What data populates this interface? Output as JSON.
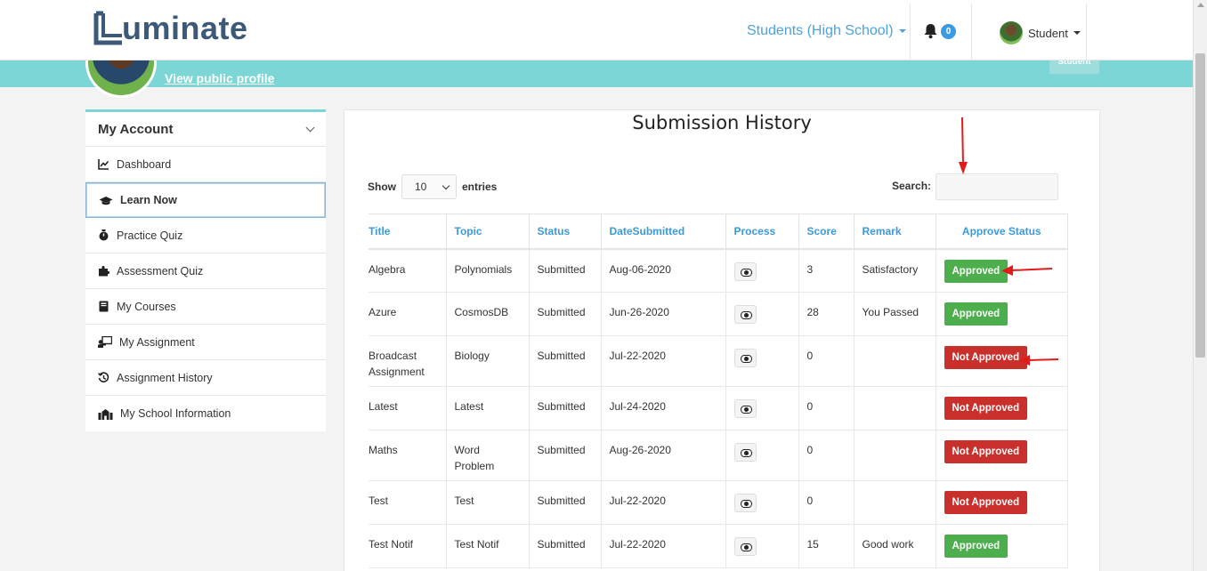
{
  "brand": {
    "name": "uminate",
    "accent": "#3c5a78"
  },
  "nav": {
    "role_menu": "Students (High School)",
    "notification_count": "0",
    "user_label": "Student"
  },
  "banner": {
    "view_profile": "View public profile",
    "role_chip": "Student",
    "color": "#7dd6d6"
  },
  "sidebar": {
    "header": "My Account",
    "items": [
      {
        "label": "Dashboard",
        "icon": "chart-line-icon"
      },
      {
        "label": "Learn Now",
        "icon": "graduation-cap-icon"
      },
      {
        "label": "Practice Quiz",
        "icon": "stopwatch-icon"
      },
      {
        "label": "Assessment Quiz",
        "icon": "puzzle-icon"
      },
      {
        "label": "My Courses",
        "icon": "book-icon"
      },
      {
        "label": "My Assignment",
        "icon": "teacher-icon"
      },
      {
        "label": "Assignment History",
        "icon": "history-icon"
      },
      {
        "label": "My School Information",
        "icon": "school-icon"
      }
    ]
  },
  "main": {
    "title": "Submission History",
    "show_label": "Show",
    "entries_value": "10",
    "entries_label": "entries",
    "search_label": "Search:",
    "search_value": "",
    "columns": [
      "Title",
      "Topic",
      "Status",
      "DateSubmitted",
      "Process",
      "Score",
      "Remark",
      "Approve Status"
    ],
    "rows": [
      {
        "title": "Algebra",
        "topic": "Polynomials",
        "status": "Submitted",
        "date": "Aug-06-2020",
        "score": "3",
        "remark": "Satisfactory",
        "approve": "Approved"
      },
      {
        "title": "Azure",
        "topic": "CosmosDB",
        "status": "Submitted",
        "date": "Jun-26-2020",
        "score": "28",
        "remark": "You Passed",
        "approve": "Approved"
      },
      {
        "title": "Broadcast Assignment",
        "topic": "Biology",
        "status": "Submitted",
        "date": "Jul-22-2020",
        "score": "0",
        "remark": "",
        "approve": "Not Approved"
      },
      {
        "title": "Latest",
        "topic": "Latest",
        "status": "Submitted",
        "date": "Jul-24-2020",
        "score": "0",
        "remark": "",
        "approve": "Not Approved"
      },
      {
        "title": "Maths",
        "topic": "Word Problem",
        "status": "Submitted",
        "date": "Aug-26-2020",
        "score": "0",
        "remark": "",
        "approve": "Not Approved"
      },
      {
        "title": "Test",
        "topic": "Test",
        "status": "Submitted",
        "date": "Jul-22-2020",
        "score": "0",
        "remark": "",
        "approve": "Not Approved"
      },
      {
        "title": "Test Notif",
        "topic": "Test Notif",
        "status": "Submitted",
        "date": "Jul-22-2020",
        "score": "15",
        "remark": "Good work",
        "approve": "Approved"
      }
    ],
    "colors": {
      "approved": "#4cae4c",
      "not_approved": "#c9302c",
      "header_link": "#3d9ad8"
    }
  }
}
